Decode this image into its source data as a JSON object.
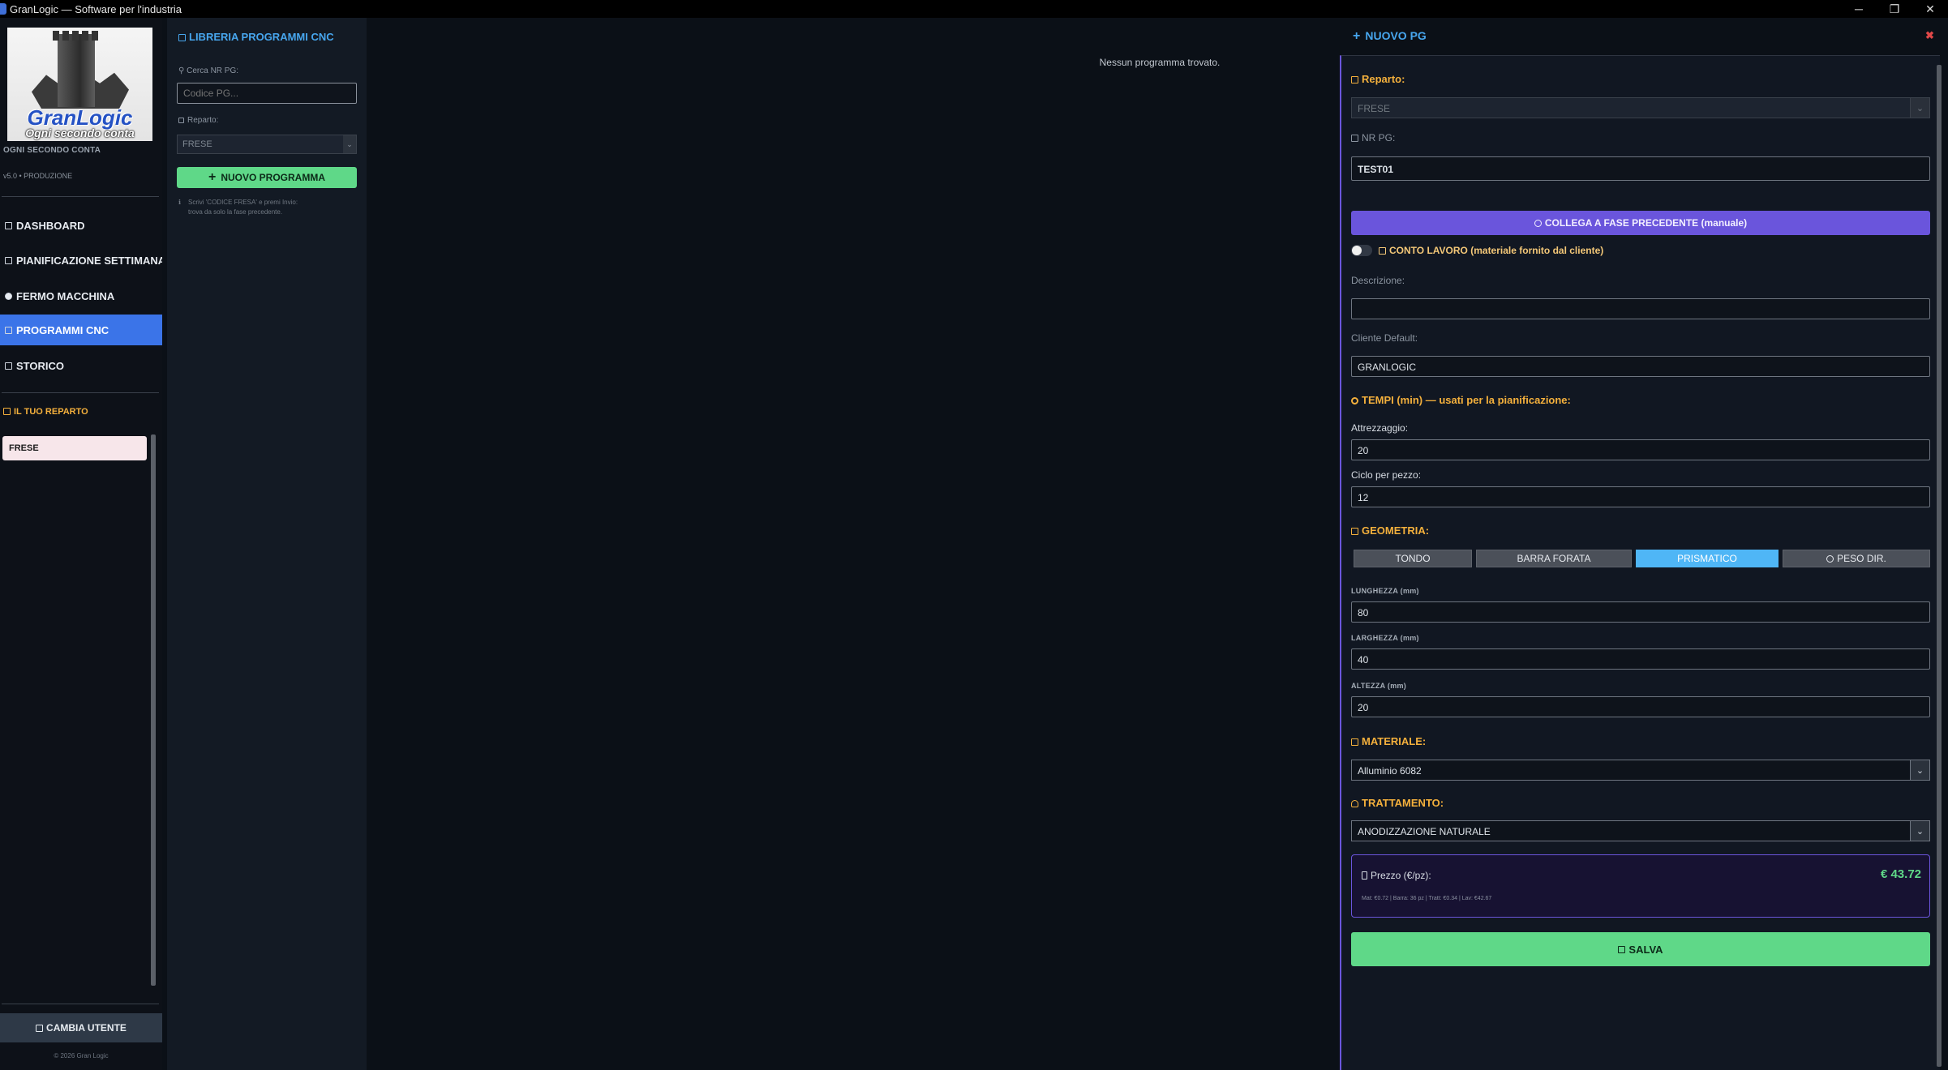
{
  "window": {
    "title": "GranLogic — Software per l'industria",
    "controls": [
      "─",
      "❐",
      "✕"
    ]
  },
  "sidebar": {
    "logo_brand": "GranLogic",
    "logo_tagline": "Ogni secondo conta",
    "slogan": "OGNI SECONDO CONTA",
    "version": "v5.0 • PRODUZIONE",
    "items": [
      {
        "label": "DASHBOARD",
        "icon": "dashboard-icon"
      },
      {
        "label": "PIANIFICAZIONE SETTIMANALE",
        "icon": "calendar-icon"
      },
      {
        "label": "FERMO MACCHINA",
        "icon": "stop-icon"
      },
      {
        "label": "PROGRAMMI CNC",
        "icon": "folder-icon",
        "active": true
      },
      {
        "label": "STORICO",
        "icon": "history-icon"
      }
    ],
    "reparto_heading": "IL TUO REPARTO",
    "reparto_value": "FRESE",
    "cambia_utente": "CAMBIA UTENTE",
    "copyright": "© 2026 Gran Logic"
  },
  "library": {
    "title": "LIBRERIA PROGRAMMI CNC",
    "search_label": "Cerca NR PG:",
    "search_placeholder": "Codice PG...",
    "reparto_label": "Reparto:",
    "reparto_value": "FRESE",
    "new_button": "NUOVO PROGRAMMA",
    "hint_line1": "Scrivi 'CODICE FRESA' e premi Invio:",
    "hint_line2": "trova da solo la fase precedente."
  },
  "main": {
    "empty_message": "Nessun programma trovato."
  },
  "form": {
    "title": "NUOVO PG",
    "reparto_label": "Reparto:",
    "reparto_value": "FRESE",
    "nrpg_label": "NR PG:",
    "nrpg_value": "TEST01",
    "collega_button": "COLLEGA A FASE PRECEDENTE (manuale)",
    "conto_lavoro_label": "CONTO LAVORO (materiale fornito dal cliente)",
    "descrizione_label": "Descrizione:",
    "descrizione_value": "",
    "cliente_label": "Cliente Default:",
    "cliente_value": "GRANLOGIC",
    "tempi_heading": "TEMPI (min) — usati per la pianificazione:",
    "attrezzaggio_label": "Attrezzaggio:",
    "attrezzaggio_value": "20",
    "ciclo_label": "Ciclo per pezzo:",
    "ciclo_value": "12",
    "geometria_heading": "GEOMETRIA:",
    "geometria_options": [
      {
        "label": "TONDO",
        "active": false
      },
      {
        "label": "BARRA FORATA",
        "active": false
      },
      {
        "label": "PRISMATICO",
        "active": true
      },
      {
        "label": "PESO DIR.",
        "active": false
      }
    ],
    "lunghezza_label": "LUNGHEZZA (mm)",
    "lunghezza_value": "80",
    "larghezza_label": "LARGHEZZA (mm)",
    "larghezza_value": "40",
    "altezza_label": "ALTEZZA (mm)",
    "altezza_value": "20",
    "materiale_heading": "MATERIALE:",
    "materiale_value": "Alluminio 6082",
    "trattamento_heading": "TRATTAMENTO:",
    "trattamento_value": "ANODIZZAZIONE NATURALE",
    "prezzo_label": "Prezzo (€/pz):",
    "prezzo_value": "€ 43.72",
    "prezzo_detail": "Mat: €0.72 | Barra: 36 pz | Tratt: €0.34 | Lav: €42.67",
    "salva_button": "SALVA"
  },
  "colors": {
    "accent_blue": "#3b74e8",
    "title_blue": "#47a6ee",
    "section_orange": "#f4b03c",
    "green": "#5fd888",
    "purple": "#6a55dc",
    "close_red": "#e04848"
  }
}
